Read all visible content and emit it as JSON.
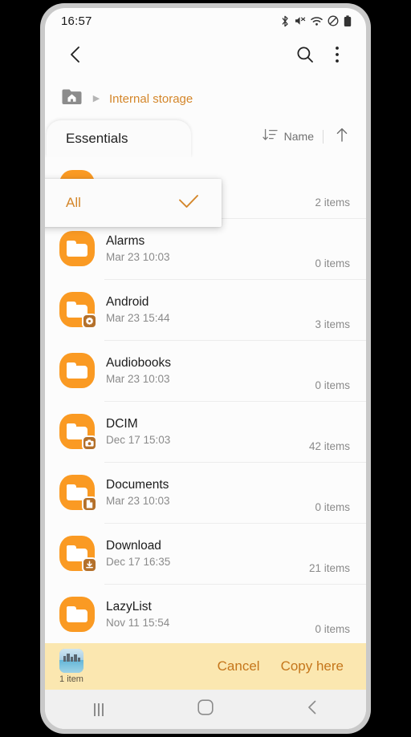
{
  "status_bar": {
    "time": "16:57",
    "icons": [
      "bluetooth-icon",
      "mute-icon",
      "wifi-icon",
      "do-not-disturb-icon",
      "battery-icon"
    ]
  },
  "app_bar": {
    "back_icon": "back-chevron-icon",
    "search_icon": "search-icon",
    "more_icon": "more-vertical-icon"
  },
  "breadcrumb": {
    "home_icon": "home-folder-icon",
    "separator": "▶",
    "current": "Internal storage"
  },
  "tabs": {
    "essentials_label": "Essentials"
  },
  "sort": {
    "icon": "sort-descending-icon",
    "label": "Name",
    "direction_icon": "arrow-up-icon"
  },
  "filter_dropdown": {
    "label": "All",
    "check_icon": "check-icon",
    "accent": "#d4862a"
  },
  "files": [
    {
      "name": "",
      "date": "",
      "count": "2 items",
      "badge": "none",
      "hidden_behind_dropdown": true
    },
    {
      "name": "Alarms",
      "date": "Mar 23 10:03",
      "count": "0 items",
      "badge": "none"
    },
    {
      "name": "Android",
      "date": "Mar 23 15:44",
      "count": "3 items",
      "badge": "gear-badge-icon"
    },
    {
      "name": "Audiobooks",
      "date": "Mar 23 10:03",
      "count": "0 items",
      "badge": "none"
    },
    {
      "name": "DCIM",
      "date": "Dec 17 15:03",
      "count": "42 items",
      "badge": "camera-badge-icon"
    },
    {
      "name": "Documents",
      "date": "Mar 23 10:03",
      "count": "0 items",
      "badge": "document-badge-icon"
    },
    {
      "name": "Download",
      "date": "Dec 17 16:35",
      "count": "21 items",
      "badge": "download-badge-icon"
    },
    {
      "name": "LazyList",
      "date": "Nov 11 15:54",
      "count": "0 items",
      "badge": "none"
    }
  ],
  "action_bar": {
    "selection_count": "1 item",
    "thumbnail_icon": "photo-thumbnail",
    "cancel_label": "Cancel",
    "copy_here_label": "Copy here",
    "background": "#fbe7b0",
    "accent": "#c5761b"
  },
  "nav_bar": {
    "recents_icon": "recents-icon",
    "home_icon": "home-circle-icon",
    "back_icon": "back-chevron-icon"
  },
  "theme": {
    "folder_orange": "#fa9a23",
    "badge_brown": "#b4702a",
    "link_orange": "#d4862a"
  }
}
